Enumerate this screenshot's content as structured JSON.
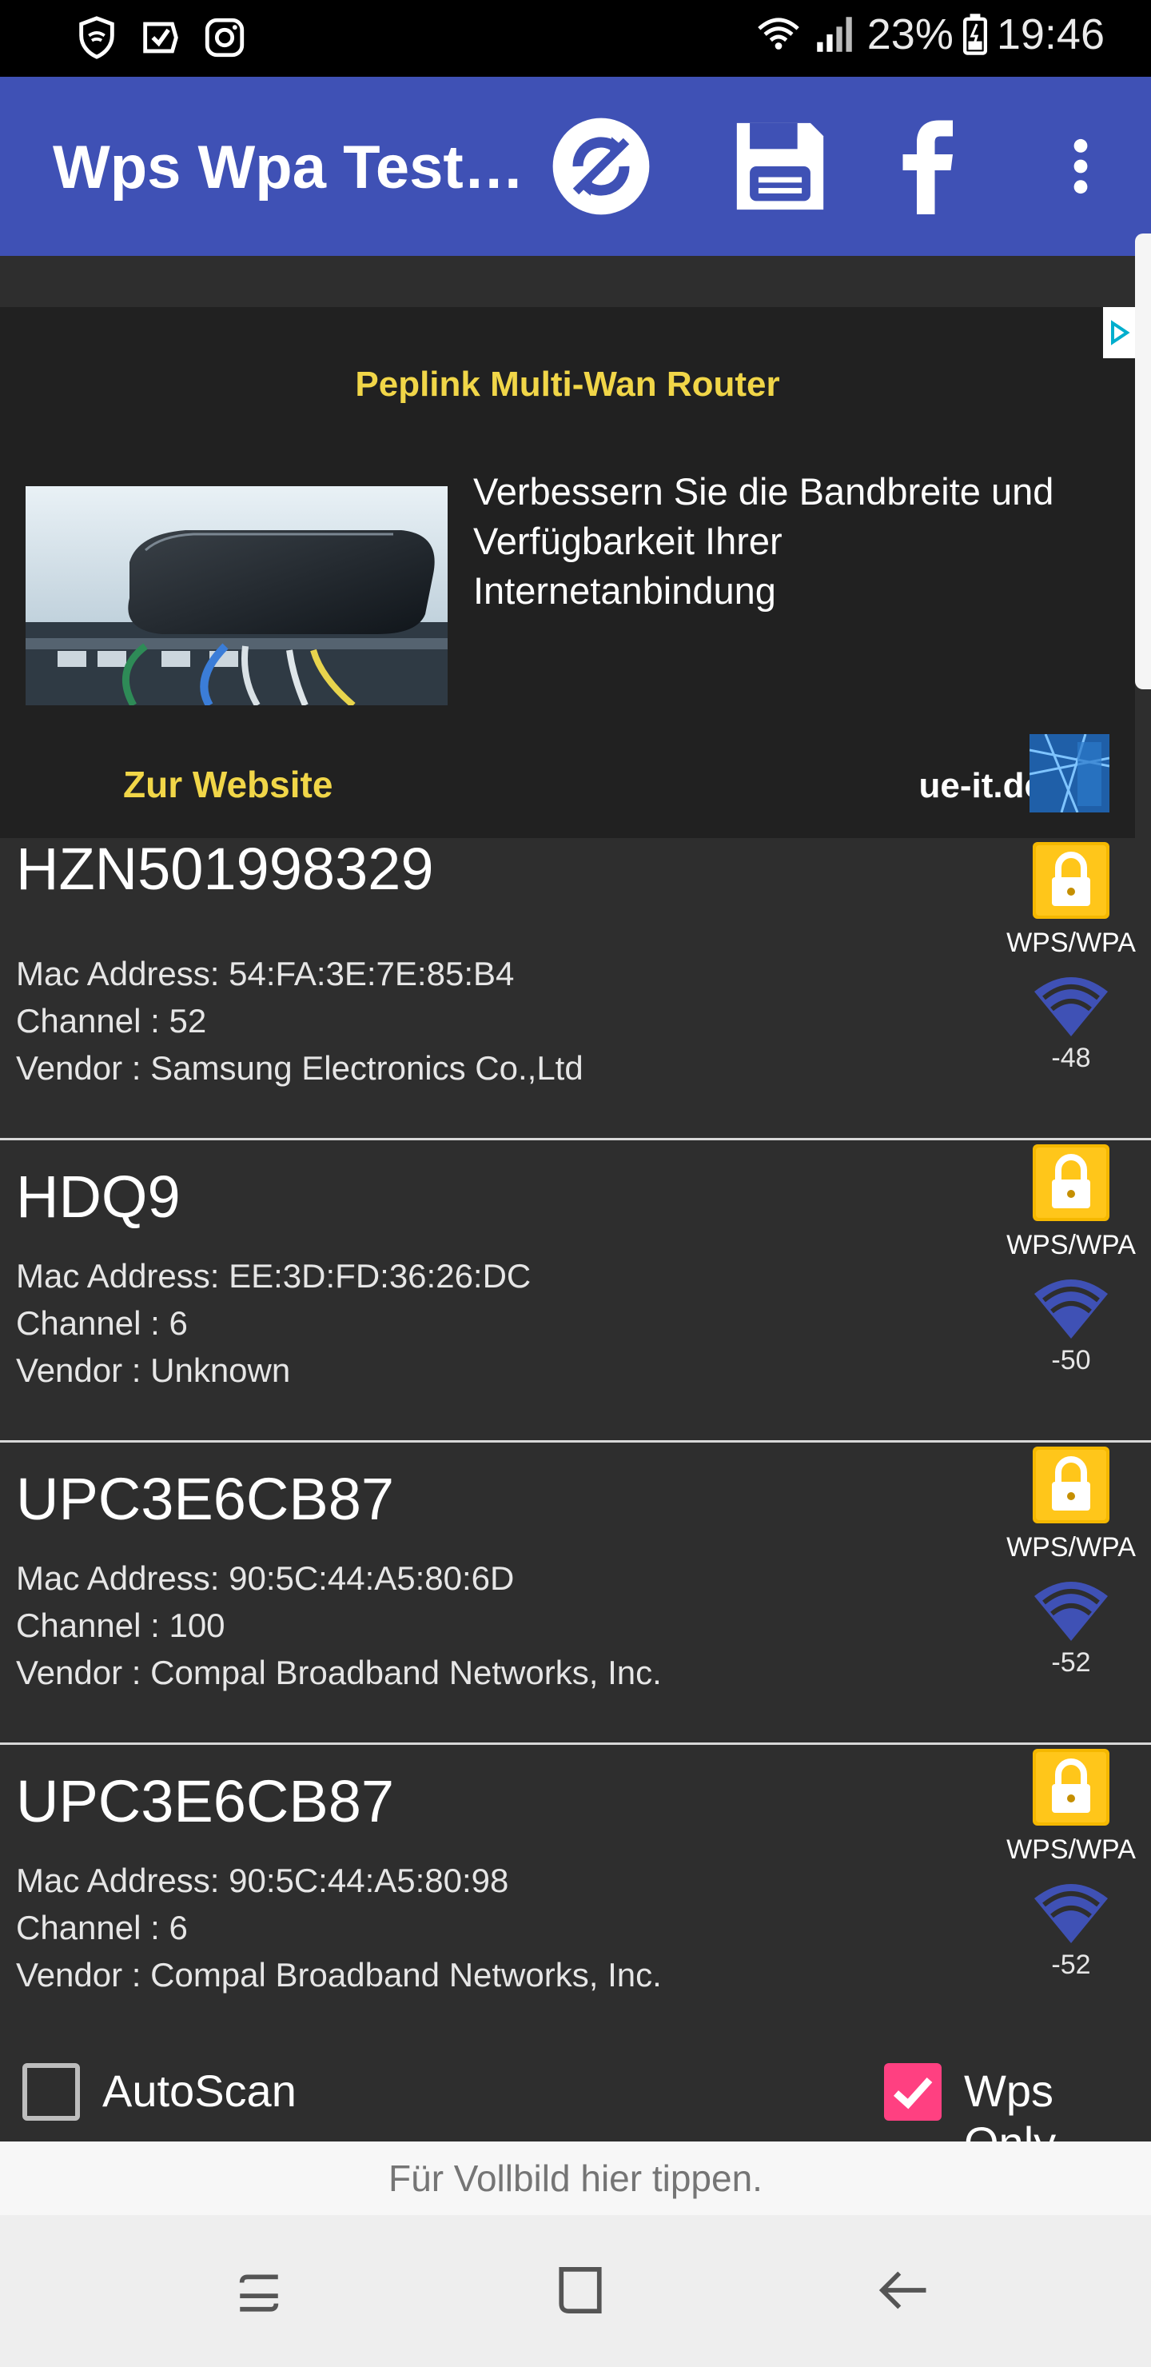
{
  "status_bar": {
    "battery": "23%",
    "time": "19:46"
  },
  "app_bar": {
    "title": "Wps Wpa Test…"
  },
  "ad": {
    "title": "Peplink Multi-Wan Router",
    "text": "Verbessern Sie die Bandbreite und Verfügbarkeit Ihrer Internetanbindung",
    "cta": "Zur Website",
    "domain": "ue-it.de"
  },
  "networks": [
    {
      "ssid": "HZN501998329",
      "mac": "Mac Address: 54:FA:3E:7E:85:B4",
      "channel": "Channel : 52",
      "vendor": "Vendor : Samsung Electronics Co.,Ltd",
      "security": "WPS/WPA",
      "rssi": "-48"
    },
    {
      "ssid": "HDQ9",
      "mac": "Mac Address: EE:3D:FD:36:26:DC",
      "channel": "Channel : 6",
      "vendor": "Vendor : Unknown",
      "security": "WPS/WPA",
      "rssi": "-50"
    },
    {
      "ssid": "UPC3E6CB87",
      "mac": "Mac Address: 90:5C:44:A5:80:6D",
      "channel": "Channel : 100",
      "vendor": "Vendor : Compal Broadband Networks, Inc.",
      "security": "WPS/WPA",
      "rssi": "-52"
    },
    {
      "ssid": "UPC3E6CB87",
      "mac": "Mac Address: 90:5C:44:A5:80:98",
      "channel": "Channel : 6",
      "vendor": "Vendor : Compal Broadband Networks, Inc.",
      "security": "WPS/WPA",
      "rssi": "-52"
    }
  ],
  "controls": {
    "autoscan_label": "AutoScan",
    "autoscan_checked": false,
    "wps_only_label": "Wps Only",
    "wps_only_checked": true
  },
  "fullscreen_hint": "Für Vollbild hier tippen.",
  "colors": {
    "app_bar": "#3f51b5",
    "ad_highlight": "#f1d648",
    "checkbox_checked": "#ff4081",
    "wifi_signal": "#3f51b5",
    "lock": "#f5b800"
  },
  "icons": [
    "wifi-status-icon",
    "check-status-icon",
    "instagram-icon",
    "refresh-icon",
    "save-icon",
    "facebook-icon",
    "more-vert-icon",
    "lock-icon",
    "wifi-signal-icon",
    "recents-icon",
    "home-icon",
    "back-icon"
  ]
}
